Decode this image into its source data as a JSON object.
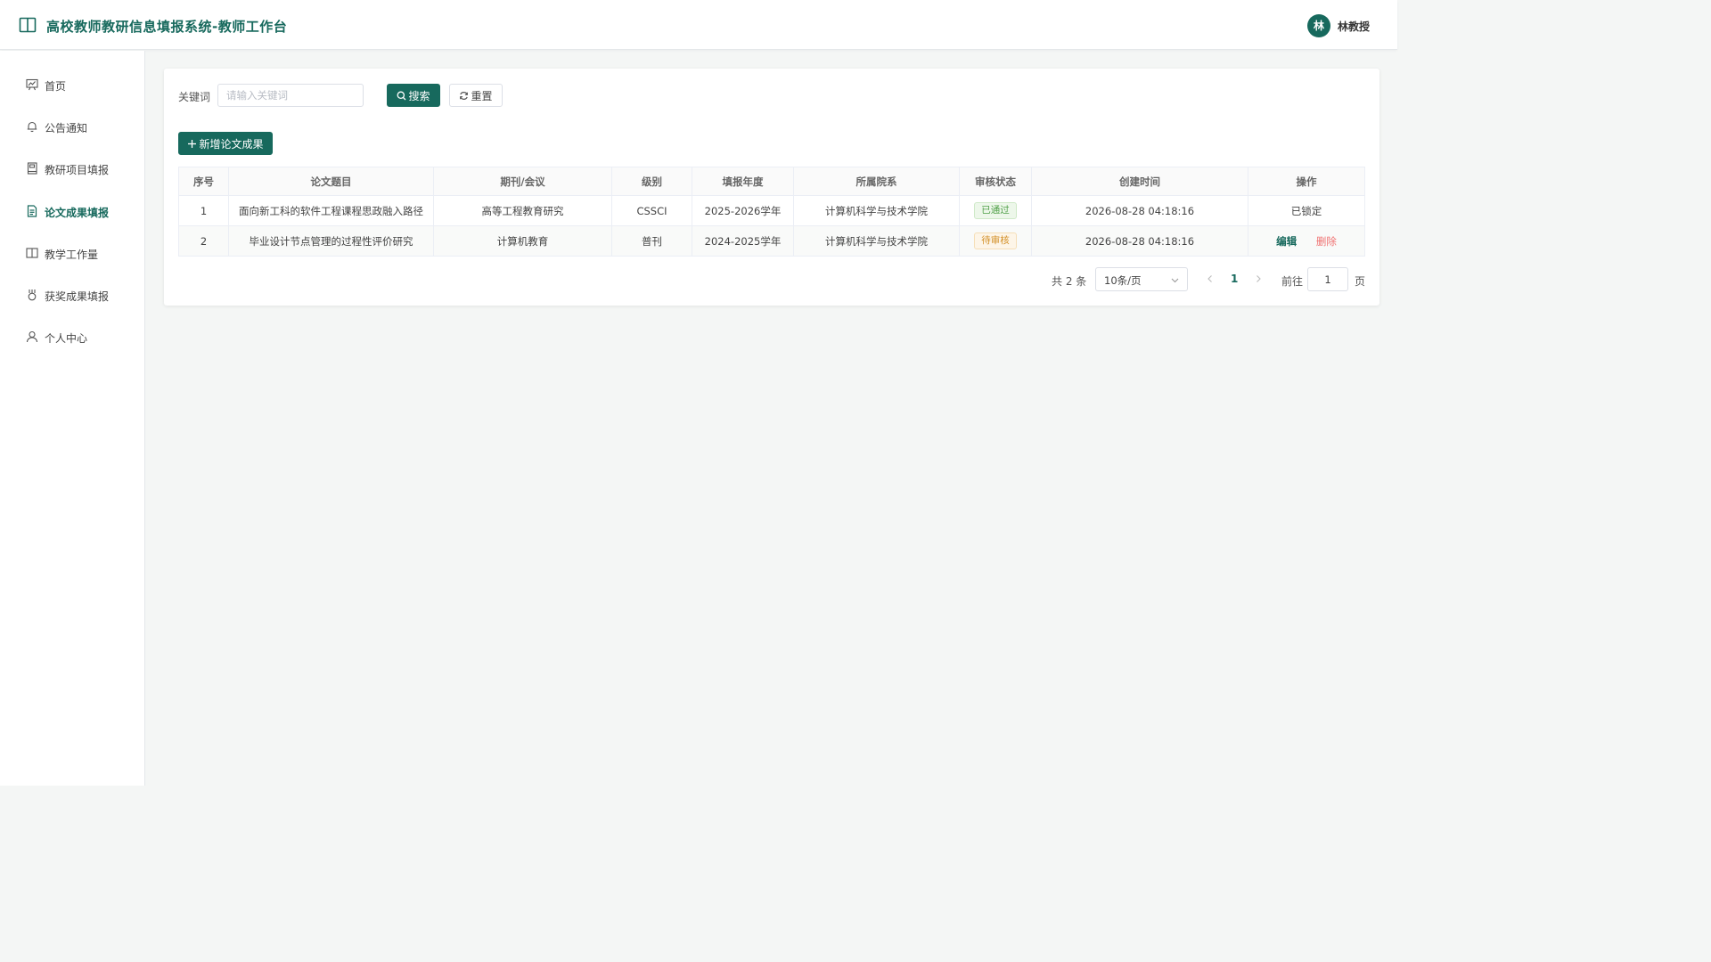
{
  "header": {
    "title": "高校教师教研信息填报系统-教师工作台",
    "avatar_initial": "林",
    "user_name": "林教授"
  },
  "sidebar": {
    "items": [
      {
        "label": "首页",
        "icon": "dashboard-icon"
      },
      {
        "label": "公告通知",
        "icon": "bell-icon"
      },
      {
        "label": "教研项目填报",
        "icon": "notebook-icon"
      },
      {
        "label": "论文成果填报",
        "icon": "document-icon",
        "active": true
      },
      {
        "label": "教学工作量",
        "icon": "book-icon"
      },
      {
        "label": "获奖成果填报",
        "icon": "medal-icon"
      },
      {
        "label": "个人中心",
        "icon": "user-icon"
      }
    ]
  },
  "search": {
    "label": "关键词",
    "placeholder": "请输入关键词",
    "value": "",
    "search_button": "搜索",
    "reset_button": "重置"
  },
  "add_button": "新增论文成果",
  "table": {
    "columns": [
      "序号",
      "论文题目",
      "期刊/会议",
      "级别",
      "填报年度",
      "所属院系",
      "审核状态",
      "创建时间",
      "操作"
    ],
    "rows": [
      {
        "index": "1",
        "title": "面向新工科的软件工程课程思政融入路径",
        "journal": "高等工程教育研究",
        "level": "CSSCI",
        "year": "2025-2026学年",
        "department": "计算机科学与技术学院",
        "status": "已通过",
        "created": "2026-08-28 04:18:16",
        "operation": "已锁定"
      },
      {
        "index": "2",
        "title": "毕业设计节点管理的过程性评价研究",
        "journal": "计算机教育",
        "level": "普刊",
        "year": "2024-2025学年",
        "department": "计算机科学与技术学院",
        "status": "待审核",
        "created": "2026-08-28 04:18:16",
        "edit": "编辑",
        "delete": "删除"
      }
    ]
  },
  "pagination": {
    "total": "共 2 条",
    "page_size": "10条/页",
    "current_page": "1",
    "goto_label": "前往",
    "goto_value": "1",
    "page_suffix": "页"
  },
  "colors": {
    "primary": "#17695d",
    "success": "#52a14a",
    "warning": "#d4922b",
    "danger": "#f07070"
  }
}
